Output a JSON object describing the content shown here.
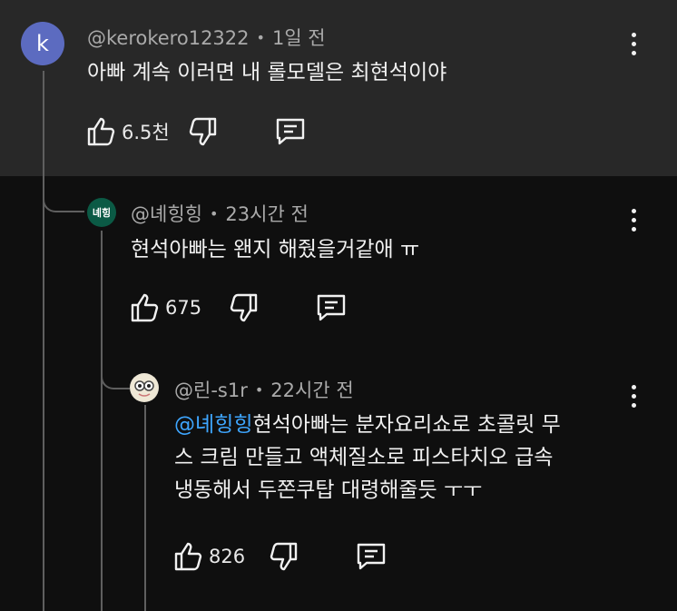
{
  "comments": [
    {
      "avatar_letter": "k",
      "author": "@kerokero12322",
      "time": "1일 전",
      "text": "아빠 계속 이러면 내 롤모델은 최현석이야",
      "likes": "6.5천"
    },
    {
      "avatar_text": "녜힝",
      "author": "@녜힝힝",
      "time": "23시간 전",
      "text": "현석아빠는 왠지 해줬을거같애 ㅠ",
      "likes": "675"
    },
    {
      "author": "@린-s1r",
      "time": "22시간 전",
      "mention": "@녜힝힝",
      "text_line1": "현석아빠는 분자요리쇼로 초콜릿 무",
      "text_line2": "스 크림 만들고 액체질소로 피스타치오 급속",
      "text_line3": "냉동해서 두쫀쿠탑 대령해줄듯 ㅜㅜ",
      "likes": "826"
    }
  ],
  "separator_dot": "•",
  "colors": {
    "mention": "#3ea6ff",
    "background": "#0f0f0f",
    "highlight": "#282828"
  },
  "icons": [
    "like-icon",
    "dislike-icon",
    "reply-icon",
    "more-vert-icon"
  ]
}
